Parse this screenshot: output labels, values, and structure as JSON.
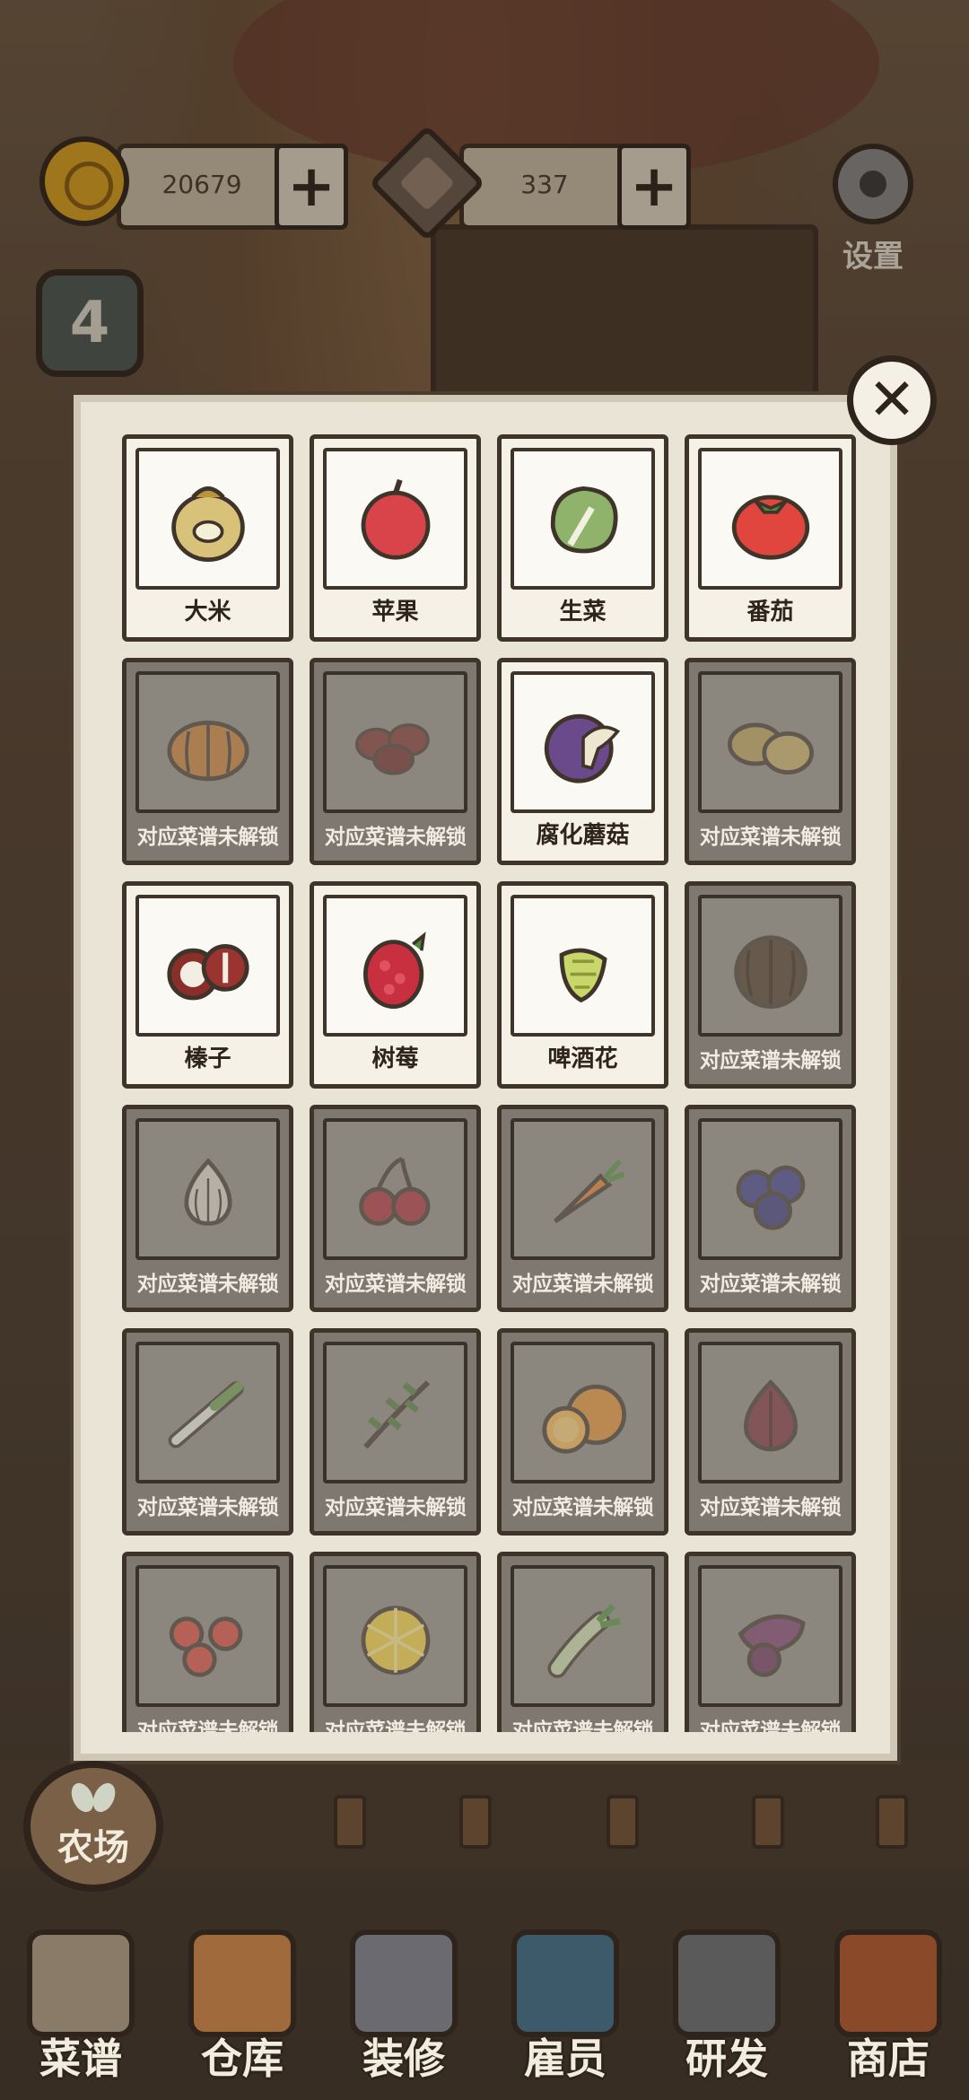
{
  "resources": {
    "coins": "20679",
    "gems": "337",
    "plus_symbol": "+"
  },
  "settings_label": "设置",
  "level": "4",
  "close_symbol": "✕",
  "ingredients": [
    {
      "name": "大米",
      "unlocked": true,
      "icon": "rice-sack-icon"
    },
    {
      "name": "苹果",
      "unlocked": true,
      "icon": "apple-icon"
    },
    {
      "name": "生菜",
      "unlocked": true,
      "icon": "lettuce-icon"
    },
    {
      "name": "番茄",
      "unlocked": true,
      "icon": "tomato-icon"
    },
    {
      "name": "对应菜谱未解锁",
      "unlocked": false,
      "icon": "pumpkin-icon"
    },
    {
      "name": "对应菜谱未解锁",
      "unlocked": false,
      "icon": "beans-icon"
    },
    {
      "name": "腐化蘑菇",
      "unlocked": true,
      "icon": "mushroom-icon"
    },
    {
      "name": "对应菜谱未解锁",
      "unlocked": false,
      "icon": "potato-icon"
    },
    {
      "name": "榛子",
      "unlocked": true,
      "icon": "hazelnut-icon"
    },
    {
      "name": "树莓",
      "unlocked": true,
      "icon": "raspberry-icon"
    },
    {
      "name": "啤酒花",
      "unlocked": true,
      "icon": "hops-icon"
    },
    {
      "name": "对应菜谱未解锁",
      "unlocked": false,
      "icon": "coconut-icon"
    },
    {
      "name": "对应菜谱未解锁",
      "unlocked": false,
      "icon": "garlic-icon"
    },
    {
      "name": "对应菜谱未解锁",
      "unlocked": false,
      "icon": "cherry-icon"
    },
    {
      "name": "对应菜谱未解锁",
      "unlocked": false,
      "icon": "carrot-icon"
    },
    {
      "name": "对应菜谱未解锁",
      "unlocked": false,
      "icon": "blueberry-icon"
    },
    {
      "name": "对应菜谱未解锁",
      "unlocked": false,
      "icon": "scallion-icon"
    },
    {
      "name": "对应菜谱未解锁",
      "unlocked": false,
      "icon": "rosemary-icon"
    },
    {
      "name": "对应菜谱未解锁",
      "unlocked": false,
      "icon": "orange-icon"
    },
    {
      "name": "对应菜谱未解锁",
      "unlocked": false,
      "icon": "onion-icon"
    },
    {
      "name": "对应菜谱未解锁",
      "unlocked": false,
      "icon": "cherry-tomato-icon"
    },
    {
      "name": "对应菜谱未解锁",
      "unlocked": false,
      "icon": "lemon-icon"
    },
    {
      "name": "对应菜谱未解锁",
      "unlocked": false,
      "icon": "celery-icon"
    },
    {
      "name": "对应菜谱未解锁",
      "unlocked": false,
      "icon": "sweet-potato-icon"
    }
  ],
  "farm_label": "农场",
  "nav": [
    {
      "label": "菜谱",
      "icon": "recipe-icon",
      "color": "#8a7a68"
    },
    {
      "label": "仓库",
      "icon": "cabinet-icon",
      "color": "#a06a3c"
    },
    {
      "label": "装修",
      "icon": "hammer-icon",
      "color": "#6a6a70"
    },
    {
      "label": "雇员",
      "icon": "employee-icon",
      "color": "#3c5a6a"
    },
    {
      "label": "研发",
      "icon": "cauldron-icon",
      "color": "#5a5a5a"
    },
    {
      "label": "商店",
      "icon": "shop-bag-icon",
      "color": "#8a4a2a"
    }
  ]
}
